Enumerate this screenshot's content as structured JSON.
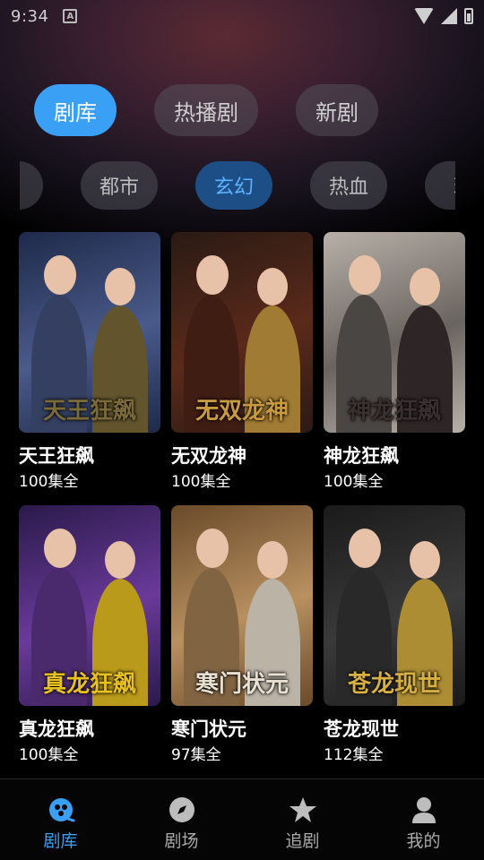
{
  "status_bar": {
    "time": "9:34",
    "notification_icon": "A"
  },
  "top_tabs": [
    {
      "label": "剧库",
      "active": true
    },
    {
      "label": "热播剧",
      "active": false
    },
    {
      "label": "新剧",
      "active": false
    }
  ],
  "categories": [
    {
      "label": "",
      "active": false
    },
    {
      "label": "都市",
      "active": false
    },
    {
      "label": "玄幻",
      "active": true
    },
    {
      "label": "热血",
      "active": false
    },
    {
      "label": "现",
      "active": false
    }
  ],
  "dramas": [
    {
      "title": "天王狂飙",
      "episodes": "100集全",
      "poster_text": "天王狂飙",
      "colors": [
        "#1e2a4a",
        "#4a5a8a",
        "#7a6a3a"
      ]
    },
    {
      "title": "无双龙神",
      "episodes": "100集全",
      "poster_text": "无双龙神",
      "colors": [
        "#2a1a14",
        "#5a2a1a",
        "#c89a40"
      ]
    },
    {
      "title": "神龙狂飙",
      "episodes": "100集全",
      "poster_text": "神龙狂飙",
      "colors": [
        "#b8b0a8",
        "#6a6460",
        "#3a3030"
      ]
    },
    {
      "title": "真龙狂飙",
      "episodes": "100集全",
      "poster_text": "真龙狂飙",
      "colors": [
        "#2a1a4a",
        "#6a3a9a",
        "#e8c020"
      ]
    },
    {
      "title": "寒门状元",
      "episodes": "97集全",
      "poster_text": "寒门状元",
      "colors": [
        "#6a4a2a",
        "#b89060",
        "#e8e0d0"
      ]
    },
    {
      "title": "苍龙现世",
      "episodes": "112集全",
      "poster_text": "苍龙现世",
      "colors": [
        "#1a1a1a",
        "#3a3a3a",
        "#d8b040"
      ]
    }
  ],
  "bottom_nav": [
    {
      "label": "剧库",
      "icon": "drama-library-icon",
      "active": true
    },
    {
      "label": "剧场",
      "icon": "compass-icon",
      "active": false
    },
    {
      "label": "追剧",
      "icon": "star-icon",
      "active": false
    },
    {
      "label": "我的",
      "icon": "profile-icon",
      "active": false
    }
  ],
  "colors": {
    "accent": "#3aa0f5",
    "chip_active_bg": "#1d4f86",
    "chip_active_text": "#5cb3ff"
  }
}
